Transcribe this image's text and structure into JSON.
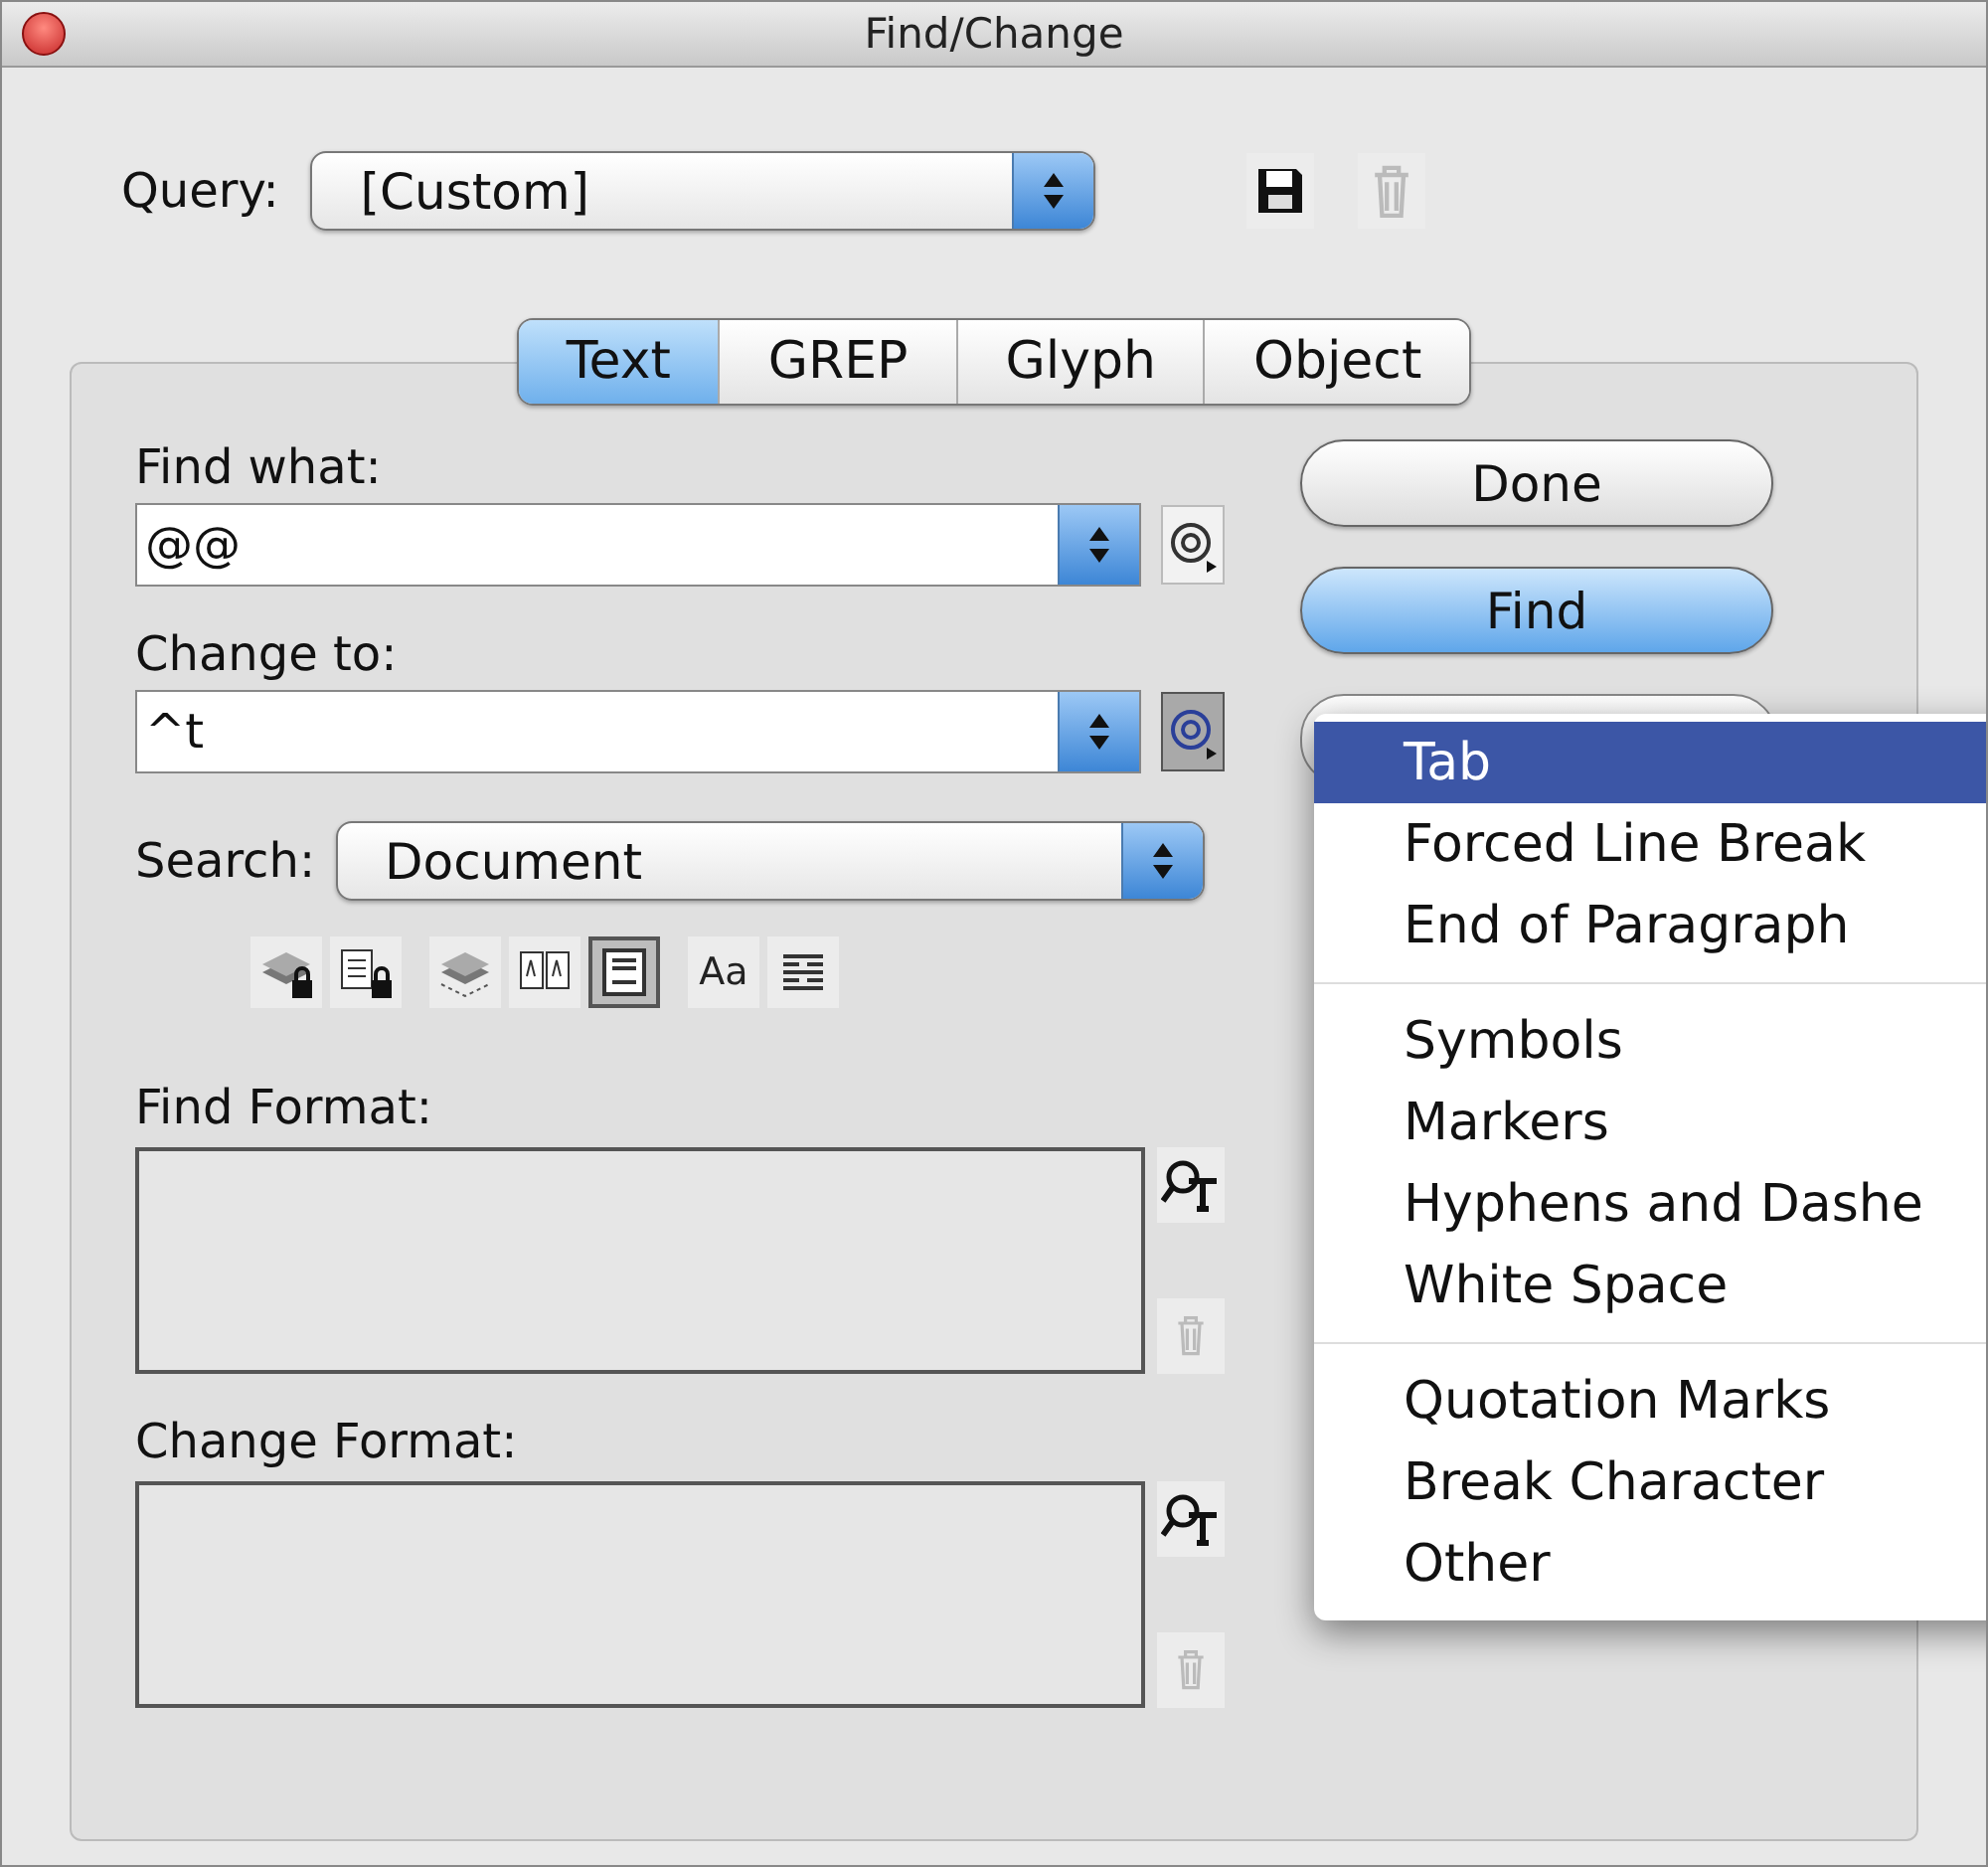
{
  "window": {
    "title": "Find/Change"
  },
  "query": {
    "label": "Query:",
    "value": "[Custom]"
  },
  "tabs": [
    {
      "label": "Text",
      "selected": true
    },
    {
      "label": "GREP",
      "selected": false
    },
    {
      "label": "Glyph",
      "selected": false
    },
    {
      "label": "Object",
      "selected": false
    }
  ],
  "find_what": {
    "label": "Find what:",
    "value": "@@"
  },
  "change_to": {
    "label": "Change to:",
    "value": "^t",
    "special_menu_open": true
  },
  "search": {
    "label": "Search:",
    "value": "Document"
  },
  "options": [
    [
      {
        "on": false
      },
      {
        "on": false
      }
    ],
    [
      {
        "on": false
      },
      {
        "on": false
      },
      {
        "on": true
      }
    ],
    [
      {
        "on": false,
        "label": "Aa"
      },
      {
        "on": false
      }
    ]
  ],
  "find_format": {
    "label": "Find Format:"
  },
  "change_format": {
    "label": "Change Format:"
  },
  "buttons": [
    {
      "label": "Done",
      "default": false
    },
    {
      "label": "Find",
      "default": true
    }
  ],
  "menu": [
    [
      {
        "label": "Tab",
        "selected": true
      },
      {
        "label": "Forced Line Break",
        "selected": false
      },
      {
        "label": "End of Paragraph",
        "selected": false
      }
    ],
    [
      {
        "label": "Symbols",
        "selected": false
      },
      {
        "label": "Markers",
        "selected": false
      },
      {
        "label": "Hyphens and Dashe",
        "selected": false
      },
      {
        "label": "White Space",
        "selected": false
      }
    ],
    [
      {
        "label": "Quotation Marks",
        "selected": false
      },
      {
        "label": "Break Character",
        "selected": false
      },
      {
        "label": "Other",
        "selected": false
      }
    ]
  ]
}
